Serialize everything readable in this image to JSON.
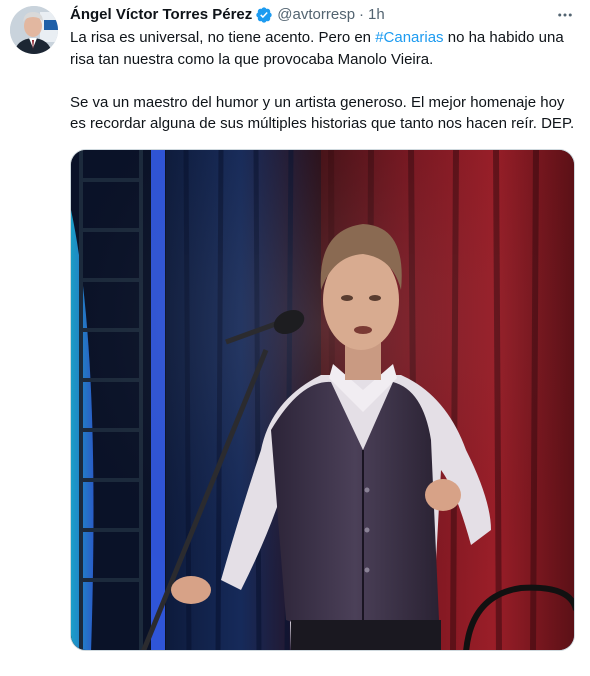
{
  "author": {
    "name": "Ángel Víctor Torres Pérez",
    "handle": "@avtorresp",
    "separator": "·",
    "time": "1h"
  },
  "tweet": {
    "line1_before": "La risa es universal, no tiene acento. Pero en ",
    "hashtag": "#Canarias",
    "line1_after": " no ha habido una risa tan nuestra como la que provocaba Manolo Vieira.",
    "paragraph2": "Se va un maestro del humor y un artista generoso. El mejor homenaje hoy es recordar alguna de sus múltiples historias que tanto nos hacen reír. DEP."
  },
  "colors": {
    "text": "#0f1419",
    "secondary": "#536471",
    "link": "#1d9bf0",
    "verified": "#1d9bf0"
  },
  "icons": {
    "verified": "verified-badge-icon",
    "more": "more-options-icon"
  }
}
